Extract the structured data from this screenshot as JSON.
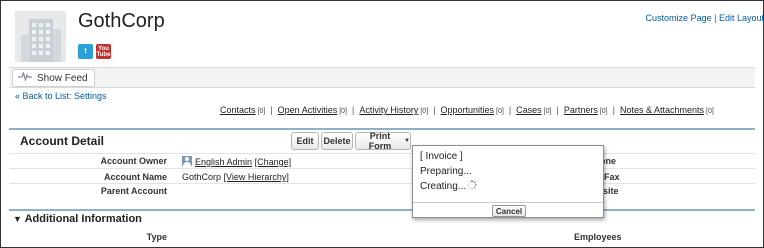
{
  "header": {
    "account_name": "GothCorp",
    "logo_icon": "building-icon",
    "twitter_icon": "twitter-icon",
    "youtube_icon": "youtube-icon",
    "youtube_text_top": "You",
    "youtube_text_bottom": "Tube",
    "twitter_text": "t",
    "links": {
      "customize_page": "Customize Page",
      "separator": "|",
      "edit_layout": "Edit Layout"
    }
  },
  "feed": {
    "show_feed_label": "Show Feed",
    "icon": "feed-pulse-icon"
  },
  "navigation": {
    "back_link": "« Back to List: Settings"
  },
  "related_lists": [
    {
      "label": "Contacts",
      "count": "[0]"
    },
    {
      "label": "Open Activities",
      "count": "[0]"
    },
    {
      "label": "Activity History",
      "count": "[0]"
    },
    {
      "label": "Opportunities",
      "count": "[0]"
    },
    {
      "label": "Cases",
      "count": "[0]"
    },
    {
      "label": "Partners",
      "count": "[0]"
    },
    {
      "label": "Notes & Attachments",
      "count": "[0]"
    }
  ],
  "detail": {
    "section_title": "Account Detail",
    "buttons": {
      "edit": "Edit",
      "delete": "Delete",
      "print_form": "Print Form"
    },
    "fields_left": [
      {
        "label": "Account Owner",
        "value": "English Admin",
        "action": "[Change]"
      },
      {
        "label": "Account Name",
        "value": "GothCorp",
        "action": "[View Hierarchy]"
      },
      {
        "label": "Parent Account",
        "value": "",
        "action": ""
      }
    ],
    "fields_right": [
      {
        "label": "one"
      },
      {
        "label": "Fax"
      },
      {
        "label": "site"
      }
    ]
  },
  "additional": {
    "section_title": "Additional Information",
    "toggle_icon": "triangle-down-icon",
    "fields": [
      {
        "label": "Type"
      },
      {
        "label": "Employees"
      }
    ]
  },
  "print_popup": {
    "line1": "[ Invoice ]",
    "line2": "Preparing...",
    "line3": "Creating...",
    "spinner_icon": "loading-spinner-icon",
    "cancel": "Cancel"
  },
  "colors": {
    "link_blue": "#015ba7",
    "twitter": "#2a9fd8",
    "youtube": "#c4302b",
    "section_rule": "#8fb0cc"
  }
}
